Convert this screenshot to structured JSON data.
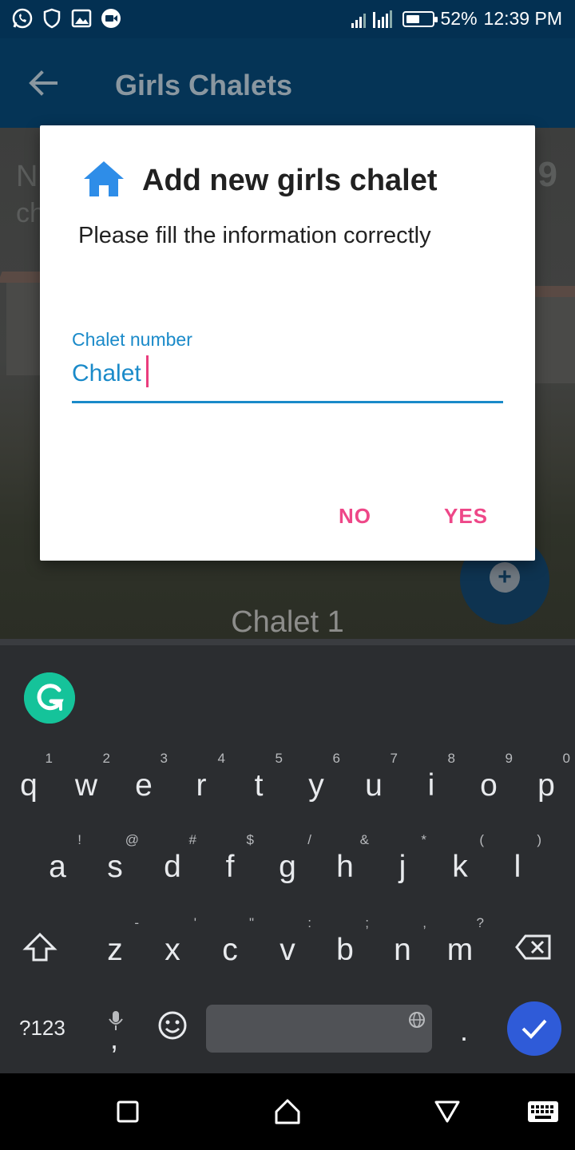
{
  "status_bar": {
    "battery_text": "52%",
    "battery_level": 0.52,
    "time": "12:39 PM",
    "icons": [
      "whatsapp-icon",
      "shield-icon",
      "image-icon",
      "video-call-icon",
      "signal-icon",
      "battery-icon"
    ]
  },
  "app_bar": {
    "title": "Girls Chalets"
  },
  "background": {
    "partial_text_top_left": "N",
    "partial_text_second_line": "ch",
    "partial_text_right": "9",
    "chalet_caption": "Chalet 1"
  },
  "dialog": {
    "title": "Add new girls chalet",
    "subtitle": "Please fill the information correctly",
    "field_label": "Chalet number",
    "field_value": "Chalet",
    "no_label": "NO",
    "yes_label": "YES"
  },
  "keyboard": {
    "row1": [
      {
        "key": "q",
        "hint": "1"
      },
      {
        "key": "w",
        "hint": "2"
      },
      {
        "key": "e",
        "hint": "3"
      },
      {
        "key": "r",
        "hint": "4"
      },
      {
        "key": "t",
        "hint": "5"
      },
      {
        "key": "y",
        "hint": "6"
      },
      {
        "key": "u",
        "hint": "7"
      },
      {
        "key": "i",
        "hint": "8"
      },
      {
        "key": "o",
        "hint": "9"
      },
      {
        "key": "p",
        "hint": "0"
      }
    ],
    "row2": [
      {
        "key": "a",
        "hint": "!"
      },
      {
        "key": "s",
        "hint": "@"
      },
      {
        "key": "d",
        "hint": "#"
      },
      {
        "key": "f",
        "hint": "$"
      },
      {
        "key": "g",
        "hint": "/"
      },
      {
        "key": "h",
        "hint": "&"
      },
      {
        "key": "j",
        "hint": "*"
      },
      {
        "key": "k",
        "hint": "("
      },
      {
        "key": "l",
        "hint": ")"
      }
    ],
    "row3": [
      {
        "key": "z",
        "hint": "-"
      },
      {
        "key": "x",
        "hint": "'"
      },
      {
        "key": "c",
        "hint": "\""
      },
      {
        "key": "v",
        "hint": ":"
      },
      {
        "key": "b",
        "hint": ";"
      },
      {
        "key": "n",
        "hint": ","
      },
      {
        "key": "m",
        "hint": "?"
      }
    ],
    "symbols_key": "?123",
    "comma_key": ",",
    "period_key": ".",
    "accent_color": "#2f5bd8",
    "grammarly_color": "#15c39a"
  },
  "colors": {
    "dialog_accent": "#1a8ac9",
    "button_color": "#ee4788",
    "home_icon": "#2e8de8"
  }
}
